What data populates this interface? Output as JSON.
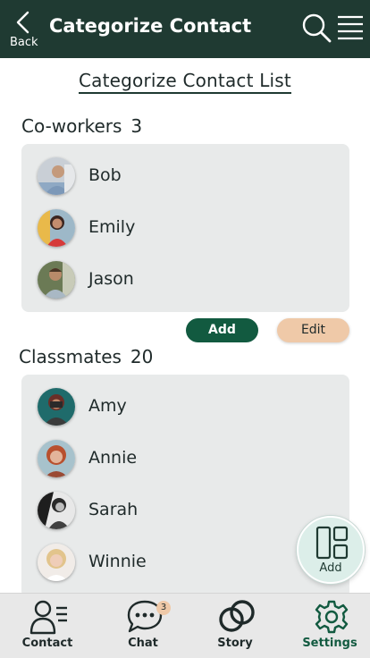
{
  "header": {
    "back_label": "Back",
    "title": "Categorize Contact",
    "background": "#1f3a32"
  },
  "page": {
    "title": "Categorize Contact List"
  },
  "groups": [
    {
      "name": "Co-workers",
      "count": "3",
      "contacts": [
        {
          "name": "Bob"
        },
        {
          "name": "Emily"
        },
        {
          "name": "Jason"
        }
      ]
    },
    {
      "name": "Classmates",
      "count": "20",
      "contacts": [
        {
          "name": "Amy"
        },
        {
          "name": "Annie"
        },
        {
          "name": "Sarah"
        },
        {
          "name": "Winnie"
        }
      ]
    }
  ],
  "actions": {
    "add_label": "Add",
    "edit_label": "Edit",
    "add_color": "#125a40",
    "edit_color": "#efc9a8"
  },
  "fab": {
    "label": "Add",
    "icon": "layout-grid-icon"
  },
  "tabbar": {
    "tabs": [
      {
        "label": "Contact",
        "icon": "contact-card-icon"
      },
      {
        "label": "Chat",
        "icon": "chat-bubble-icon",
        "badge": "3"
      },
      {
        "label": "Story",
        "icon": "linked-rings-icon"
      },
      {
        "label": "Settings",
        "icon": "gear-icon",
        "active": true
      }
    ],
    "active_color": "#125a40"
  }
}
